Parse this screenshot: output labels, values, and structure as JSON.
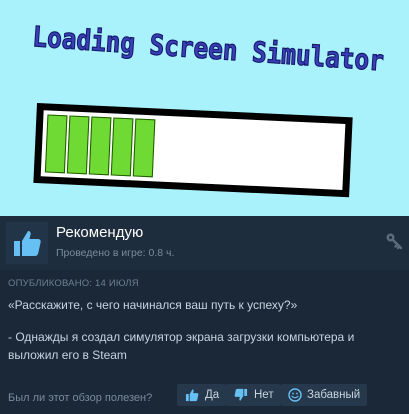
{
  "banner": {
    "title": "Loading Screen Simulator",
    "progress_segments_filled": 5
  },
  "review": {
    "recommendation": "Рекомендую",
    "playtime": "Проведено в игре: 0.8 ч.",
    "published": "ОПУБЛИКОВАНО: 14 ИЮЛЯ",
    "paragraph1": "«Расскажите, с чего начинался ваш путь к успеху?»",
    "paragraph2": "- Однажды я создал симулятор экрана загрузки компьютера и выложил его в Steam"
  },
  "feedback": {
    "question": "Был ли этот обзор полезен?",
    "yes_label": "Да",
    "no_label": "Нет",
    "funny_label": "Забавный"
  },
  "colors": {
    "banner_bg": "#a9f1fb",
    "progress_fill": "#6fda33",
    "panel_bg": "#1b2838"
  }
}
